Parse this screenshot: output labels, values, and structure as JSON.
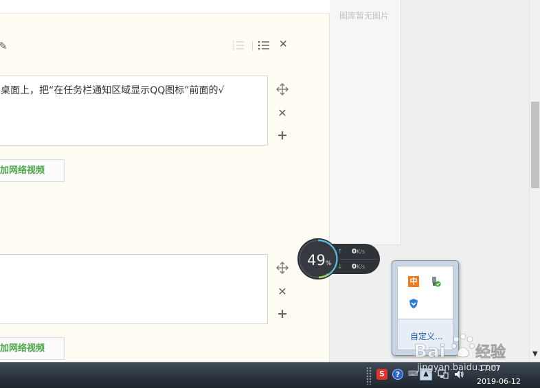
{
  "editor": {
    "block1_text": "桌面上，把“在任务栏通知区域显示QQ图标”前面的√",
    "block2_text": "",
    "video_button_1": "加网络视频",
    "video_button_2": "加网络视频",
    "icons": [
      "pencil-icon",
      "ordered-list-icon",
      "unordered-list-icon",
      "close-icon",
      "move-icon",
      "delete-icon",
      "add-icon"
    ]
  },
  "gallery": {
    "empty_text": "图库暂无图片"
  },
  "net_widget": {
    "percent": "49",
    "percent_unit": "%",
    "upload_value": "0",
    "upload_unit": "K/s",
    "download_value": "0",
    "download_unit": "K/s"
  },
  "tray_popup": {
    "ime_label": "中",
    "customize_label": "自定义..."
  },
  "taskbar": {
    "sogou_label": "S",
    "help_label": "?",
    "time": "17:07",
    "date": "2019-06-12"
  },
  "watermark": {
    "brand": "Bai",
    "brand_cn": "经验",
    "url": "jingyan.baidu.com"
  }
}
